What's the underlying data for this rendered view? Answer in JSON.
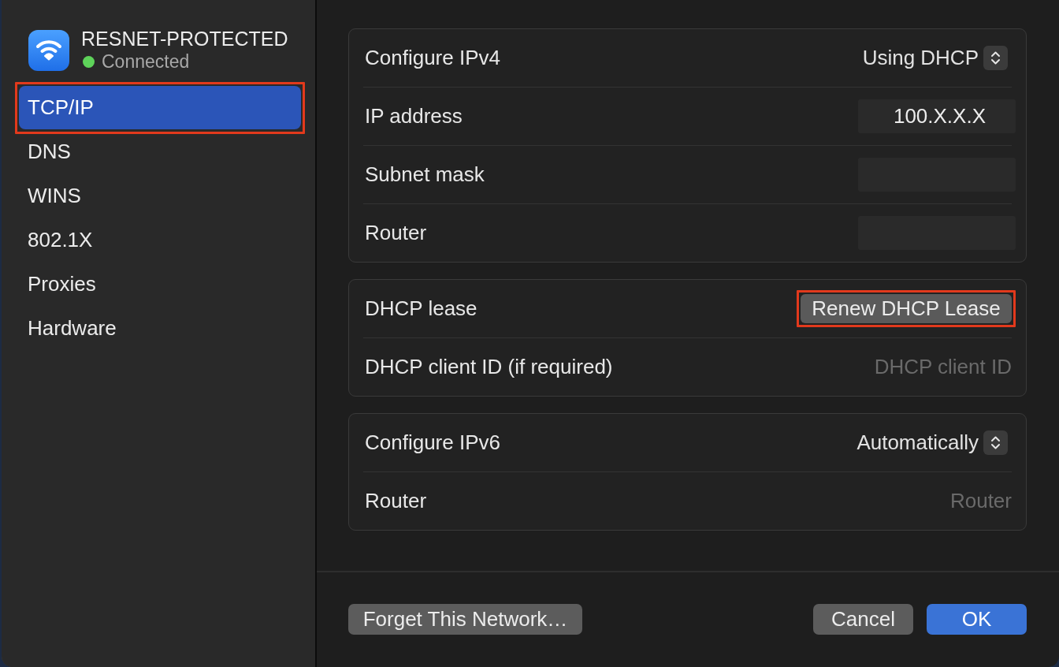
{
  "network": {
    "name": "RESNET-PROTECTED",
    "status": "Connected",
    "connected": true
  },
  "sidebar": {
    "items": [
      {
        "label": "TCP/IP",
        "selected": true,
        "highlighted": true
      },
      {
        "label": "DNS",
        "selected": false,
        "highlighted": false
      },
      {
        "label": "WINS",
        "selected": false,
        "highlighted": false
      },
      {
        "label": "802.1X",
        "selected": false,
        "highlighted": false
      },
      {
        "label": "Proxies",
        "selected": false,
        "highlighted": false
      },
      {
        "label": "Hardware",
        "selected": false,
        "highlighted": false
      }
    ]
  },
  "sections": [
    {
      "rows": [
        {
          "kind": "popup",
          "label": "Configure IPv4",
          "value": "Using DHCP"
        },
        {
          "kind": "field",
          "label": "IP address",
          "value": "100.X.X.X",
          "disabled": true
        },
        {
          "kind": "field",
          "label": "Subnet mask",
          "disabled": true
        },
        {
          "kind": "field",
          "label": "Router",
          "disabled": true
        }
      ]
    },
    {
      "rows": [
        {
          "kind": "button",
          "label": "DHCP lease",
          "button": "Renew DHCP Lease",
          "highlighted": true
        },
        {
          "kind": "field",
          "label": "DHCP client ID (if required)",
          "placeholder": "DHCP client ID",
          "disabled": false
        }
      ]
    },
    {
      "rows": [
        {
          "kind": "popup",
          "label": "Configure IPv6",
          "value": "Automatically"
        },
        {
          "kind": "field",
          "label": "Router",
          "placeholder": "Router",
          "disabled": false
        }
      ]
    }
  ],
  "footer": {
    "left_buttons": [
      {
        "label": "Forget This Network…",
        "kind": "secondary"
      }
    ],
    "right_buttons": [
      {
        "label": "Cancel",
        "kind": "secondary"
      },
      {
        "label": "OK",
        "kind": "default"
      }
    ]
  }
}
